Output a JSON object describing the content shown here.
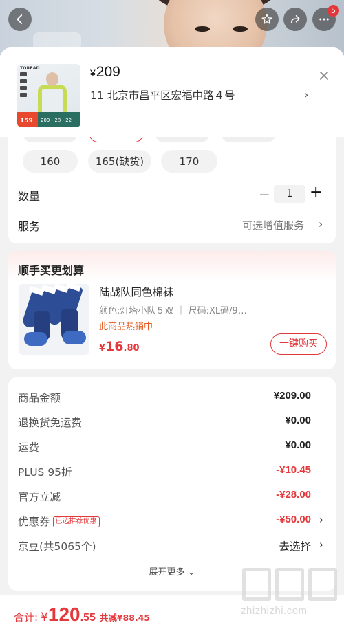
{
  "top_bar": {
    "cart_badge": "5"
  },
  "product": {
    "currency": "¥",
    "price": "209",
    "thumbnail": {
      "brand": "TOREAD",
      "promo_price": "159",
      "mini_text": "209 - 28 - 22"
    }
  },
  "address": {
    "text": "11  北京市昌平区宏福中路４号"
  },
  "sizes": {
    "options": [
      {
        "label": "160"
      },
      {
        "label": "165(缺货)"
      },
      {
        "label": "170"
      }
    ]
  },
  "quantity": {
    "label": "数量",
    "minus": "−",
    "value": "1",
    "plus": "+"
  },
  "service": {
    "label": "服务",
    "value": "可选增值服务"
  },
  "bundle": {
    "title": "顺手买更划算",
    "item_name": "陆战队同色棉袜",
    "item_spec": "颜色:灯塔小队５双 ｜ 尺码:XL码/9…",
    "item_status": "此商品热销中",
    "price_symbol": "¥",
    "price_int": "16",
    "price_dec": ".80",
    "buy_label": "一键购买"
  },
  "fees": [
    {
      "label": "商品金额",
      "value": "¥209.00",
      "style": "normal"
    },
    {
      "label": "退换货免运费",
      "value": "¥0.00",
      "style": "normal"
    },
    {
      "label": "运费",
      "value": "¥0.00",
      "style": "normal"
    },
    {
      "label": "PLUS 95折",
      "value": "-¥10.45",
      "style": "red"
    },
    {
      "label": "官方立减",
      "value": "-¥28.00",
      "style": "red"
    },
    {
      "label": "优惠券",
      "tag": "已选推荐优惠",
      "value": "-¥50.00",
      "style": "red"
    },
    {
      "label": "京豆(共5065个)",
      "value": "去选择",
      "style": "plain"
    }
  ],
  "expand_label": "展开更多",
  "footer": {
    "total_label": "合计:",
    "symbol": "¥",
    "total_int": "120",
    "total_dec": ".55",
    "saving": "共减¥88.45"
  },
  "watermark": {
    "text": "zhizhizhi.com"
  },
  "colors": {
    "accent": "#e4393c",
    "hot": "#e05a1f",
    "background": "#f2f2f2"
  },
  "icons": [
    "back-icon",
    "star-icon",
    "share-icon",
    "more-icon",
    "close-icon",
    "chevron-right-icon"
  ]
}
